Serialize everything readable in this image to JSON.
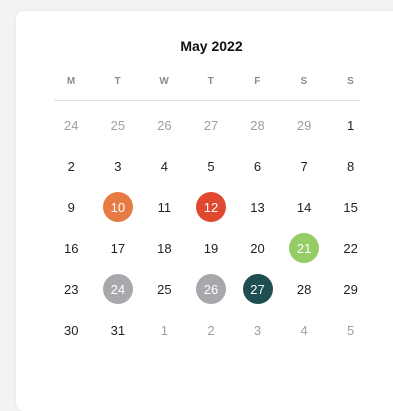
{
  "calendar": {
    "title": "May 2022",
    "weekdays": [
      "M",
      "T",
      "W",
      "T",
      "F",
      "S",
      "S"
    ],
    "weeks": [
      [
        {
          "label": "24",
          "muted": true
        },
        {
          "label": "25",
          "muted": true
        },
        {
          "label": "26",
          "muted": true
        },
        {
          "label": "27",
          "muted": true
        },
        {
          "label": "28",
          "muted": true
        },
        {
          "label": "29",
          "muted": true
        },
        {
          "label": "1"
        }
      ],
      [
        {
          "label": "2"
        },
        {
          "label": "3"
        },
        {
          "label": "4"
        },
        {
          "label": "5"
        },
        {
          "label": "6"
        },
        {
          "label": "7"
        },
        {
          "label": "8"
        }
      ],
      [
        {
          "label": "9"
        },
        {
          "label": "10",
          "highlight": "orange"
        },
        {
          "label": "11"
        },
        {
          "label": "12",
          "highlight": "red"
        },
        {
          "label": "13"
        },
        {
          "label": "14"
        },
        {
          "label": "15"
        }
      ],
      [
        {
          "label": "16"
        },
        {
          "label": "17"
        },
        {
          "label": "18"
        },
        {
          "label": "19"
        },
        {
          "label": "20"
        },
        {
          "label": "21",
          "highlight": "green"
        },
        {
          "label": "22"
        }
      ],
      [
        {
          "label": "23"
        },
        {
          "label": "24",
          "highlight": "gray"
        },
        {
          "label": "25"
        },
        {
          "label": "26",
          "highlight": "gray"
        },
        {
          "label": "27",
          "highlight": "teal"
        },
        {
          "label": "28"
        },
        {
          "label": "29"
        }
      ],
      [
        {
          "label": "30"
        },
        {
          "label": "31"
        },
        {
          "label": "1",
          "muted": true
        },
        {
          "label": "2",
          "muted": true
        },
        {
          "label": "3",
          "muted": true
        },
        {
          "label": "4",
          "muted": true
        },
        {
          "label": "5",
          "muted": true
        }
      ]
    ]
  },
  "colors": {
    "orange": "#e67b43",
    "red": "#e0492f",
    "green": "#95cc66",
    "gray": "#a6a8ab",
    "teal": "#1f4e52"
  }
}
